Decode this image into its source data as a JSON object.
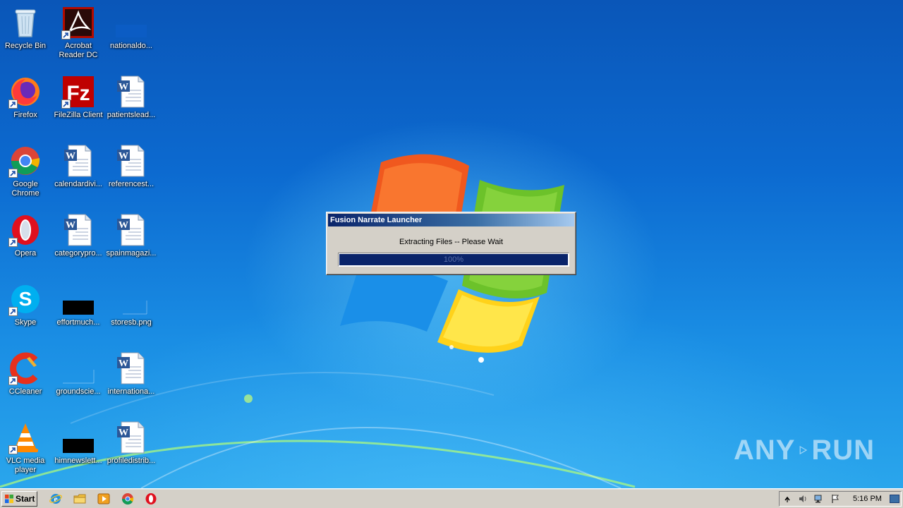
{
  "desktop": {
    "icons": [
      {
        "label": "Recycle Bin",
        "icon": "recycle-bin-icon"
      },
      {
        "label": "Acrobat Reader DC",
        "icon": "acrobat-icon"
      },
      {
        "label": "nationaldo...",
        "icon": "blank-file-icon"
      },
      {
        "label": "Firefox",
        "icon": "firefox-icon"
      },
      {
        "label": "FileZilla Client",
        "icon": "filezilla-icon"
      },
      {
        "label": "patientslead...",
        "icon": "word-doc-icon"
      },
      {
        "label": "Google Chrome",
        "icon": "chrome-icon"
      },
      {
        "label": "calendardivi...",
        "icon": "word-doc-icon"
      },
      {
        "label": "referencest...",
        "icon": "word-doc-icon"
      },
      {
        "label": "Opera",
        "icon": "opera-icon"
      },
      {
        "label": "categorypro...",
        "icon": "word-doc-icon"
      },
      {
        "label": "spainmagazi...",
        "icon": "word-doc-icon"
      },
      {
        "label": "Skype",
        "icon": "skype-icon"
      },
      {
        "label": "effortmuch...",
        "icon": "black-image-icon"
      },
      {
        "label": "storesb.png",
        "icon": "blank-file-icon"
      },
      {
        "label": "CCleaner",
        "icon": "ccleaner-icon"
      },
      {
        "label": "groundscie...",
        "icon": "blank-file-icon"
      },
      {
        "label": "internationa...",
        "icon": "word-doc-icon"
      },
      {
        "label": "VLC media player",
        "icon": "vlc-icon"
      },
      {
        "label": "himnewslett...",
        "icon": "black-image-icon"
      },
      {
        "label": "profiledistrib...",
        "icon": "word-doc-icon"
      }
    ]
  },
  "dialog": {
    "title": "Fusion Narrate Launcher",
    "message": "Extracting Files -- Please Wait",
    "progress_text": "100%",
    "progress_value": 100
  },
  "watermark": {
    "left": "ANY",
    "right": "RUN"
  },
  "taskbar": {
    "start_label": "Start",
    "quick_launch": [
      "ie-icon",
      "folder-icon",
      "media-player-icon",
      "chrome-icon",
      "opera-icon"
    ],
    "tray_icons": [
      "show-hidden-icon",
      "volume-icon",
      "network-icon",
      "flag-icon"
    ],
    "clock": "5:16 PM"
  },
  "colors": {
    "titlebar_start": "#0a246a",
    "titlebar_end": "#a6caf0",
    "progress_fill": "#0a246a",
    "window_face": "#d4d0c8"
  }
}
